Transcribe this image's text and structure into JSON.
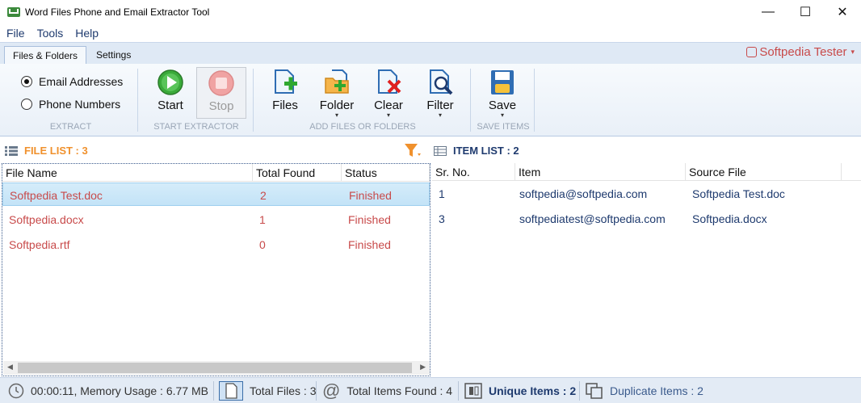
{
  "window": {
    "title": "Word Files Phone and Email Extractor Tool",
    "controls": {
      "minimize": "—",
      "maximize": "☐",
      "close": "✕"
    }
  },
  "menu": [
    "File",
    "Tools",
    "Help"
  ],
  "tabs": [
    {
      "label": "Files & Folders",
      "active": true
    },
    {
      "label": "Settings",
      "active": false
    }
  ],
  "user": {
    "name": "Softpedia Tester",
    "caret": "▾"
  },
  "ribbon": {
    "extract": {
      "group_label": "EXTRACT",
      "options": [
        {
          "label": "Email Addresses",
          "selected": true
        },
        {
          "label": "Phone Numbers",
          "selected": false
        }
      ]
    },
    "start_extractor": {
      "group_label": "START EXTRACTOR",
      "start_label": "Start",
      "stop_label": "Stop"
    },
    "add_files": {
      "group_label": "ADD FILES OR FOLDERS",
      "files_label": "Files",
      "folder_label": "Folder",
      "clear_label": "Clear",
      "filter_label": "Filter"
    },
    "save_items": {
      "group_label": "SAVE ITEMS",
      "save_label": "Save"
    },
    "caret": "▾"
  },
  "file_list": {
    "header": "FILE LIST : 3",
    "columns": [
      "File Name",
      "Total Found",
      "Status"
    ],
    "rows": [
      {
        "file": "Softpedia Test.doc",
        "found": "2",
        "status": "Finished",
        "selected": true
      },
      {
        "file": "Softpedia.docx",
        "found": "1",
        "status": "Finished",
        "selected": false
      },
      {
        "file": "Softpedia.rtf",
        "found": "0",
        "status": "Finished",
        "selected": false
      }
    ]
  },
  "item_list": {
    "header": "ITEM LIST : 2",
    "columns": [
      "Sr. No.",
      "Item",
      "Source File"
    ],
    "rows": [
      {
        "sr": "1",
        "item": "softpedia@softpedia.com",
        "source": "Softpedia Test.doc"
      },
      {
        "sr": "3",
        "item": "softpediatest@softpedia.com",
        "source": "Softpedia.docx"
      }
    ]
  },
  "status_bar": {
    "time_memory": "00:00:11, Memory Usage : 6.77 MB",
    "total_files": "Total Files : 3",
    "total_items": "Total Items Found : 4",
    "unique_items": "Unique Items : 2",
    "duplicate_items": "Duplicate Items : 2"
  },
  "colors": {
    "accent_orange": "#f0912d",
    "file_red": "#c84a4a",
    "item_blue": "#1e3a6e"
  }
}
